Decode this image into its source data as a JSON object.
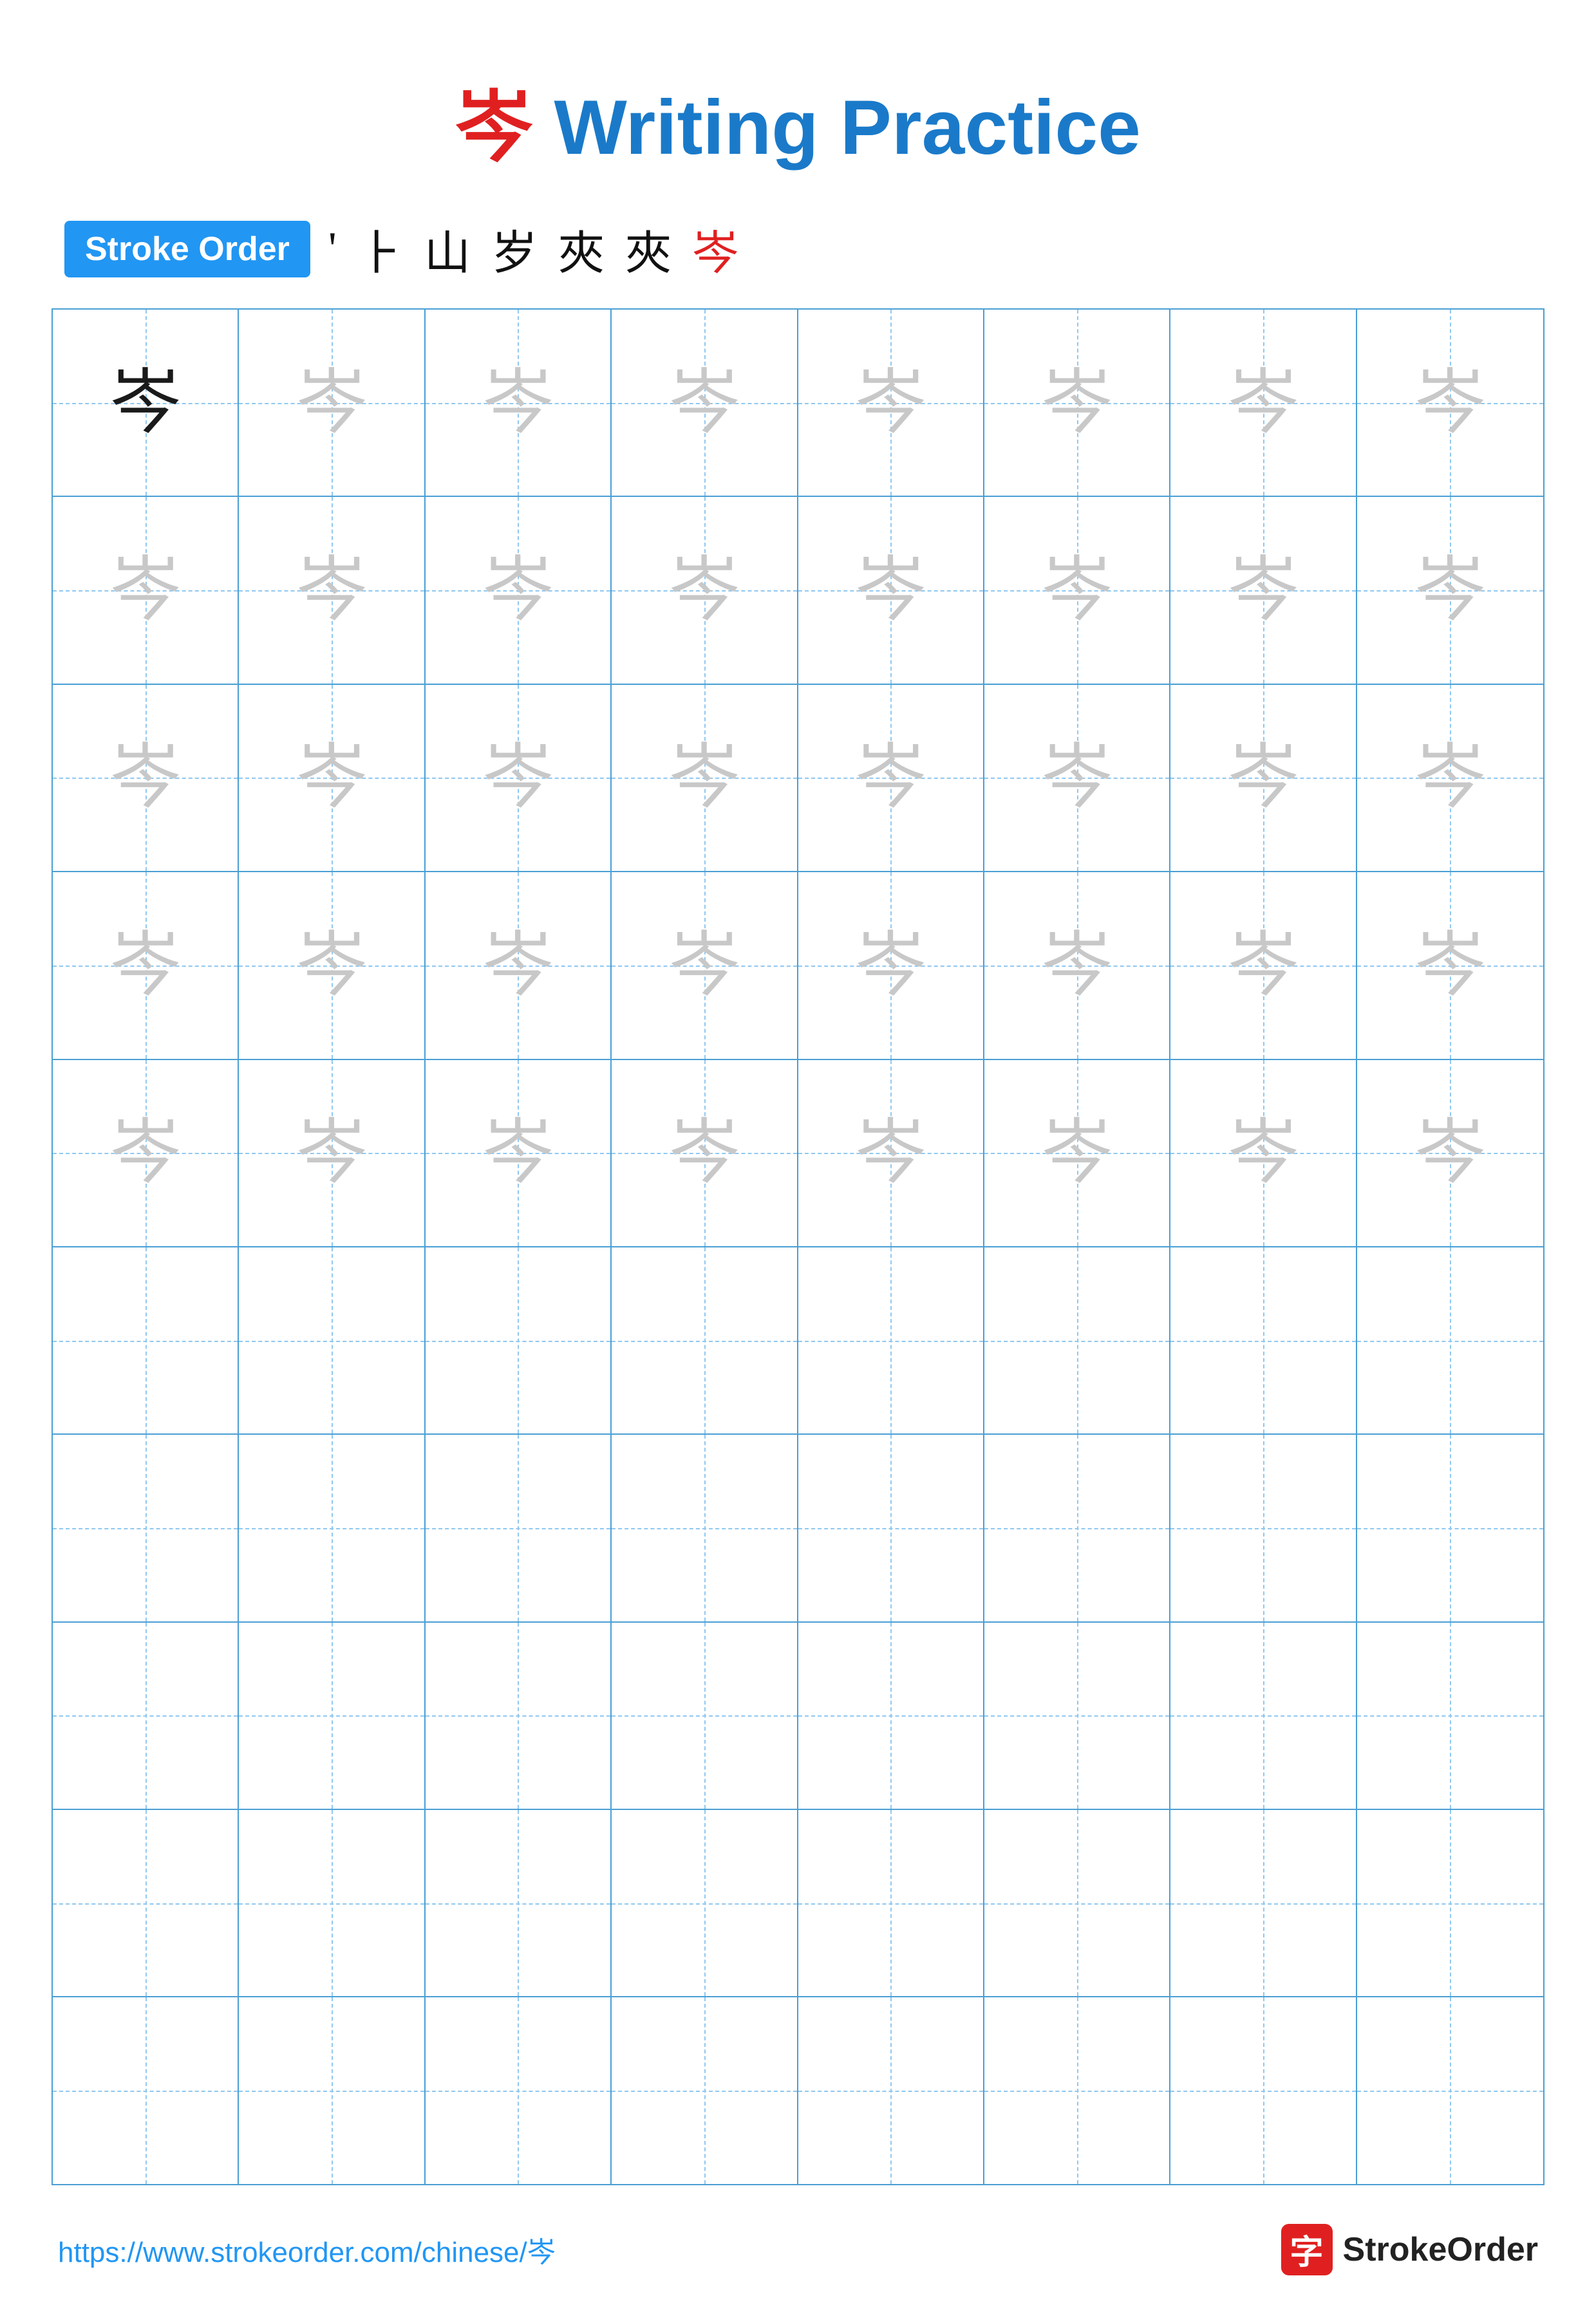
{
  "title": {
    "char": "岑",
    "label": "Writing Practice",
    "color_char": "#e02020",
    "color_text": "#1a7ac9"
  },
  "stroke_order": {
    "badge_label": "Stroke Order",
    "steps": [
      "'",
      "⺊",
      "山",
      "岁",
      "夾",
      "夾",
      "岑"
    ],
    "steps_colors": [
      "black",
      "black",
      "black",
      "black",
      "black",
      "black",
      "red"
    ]
  },
  "grid": {
    "char": "岑",
    "rows": 10,
    "cols": 8,
    "practice_rows_with_char": 5,
    "empty_rows": 5
  },
  "footer": {
    "url": "https://www.strokeorder.com/chinese/岑",
    "brand_name": "StrokeOrder",
    "brand_char": "字"
  }
}
